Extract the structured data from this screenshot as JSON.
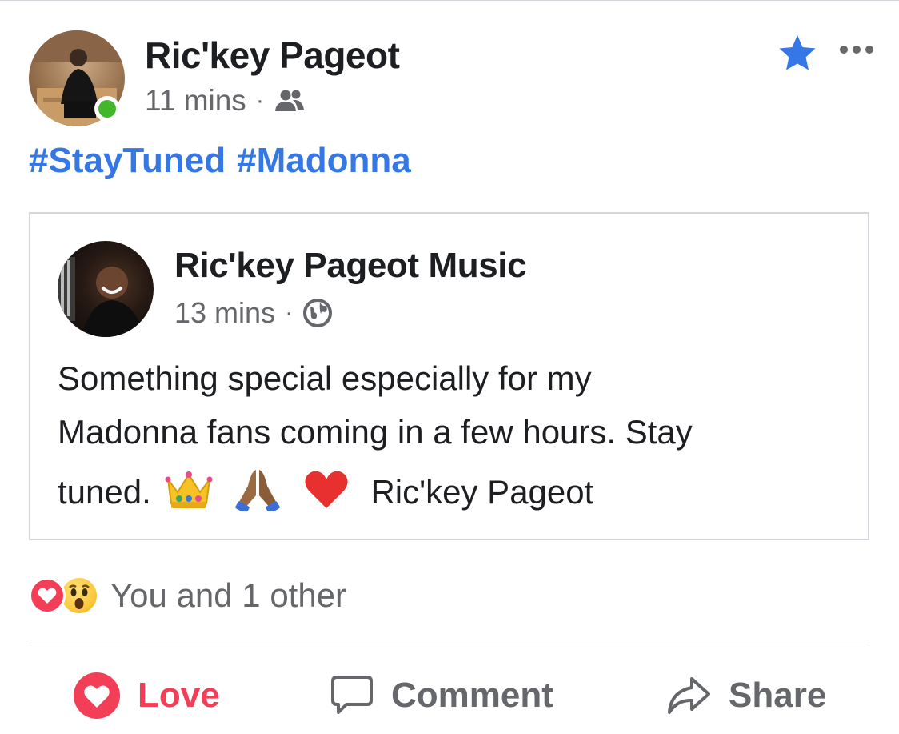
{
  "post": {
    "author": "Ric'key Pageot",
    "time": "11 mins",
    "separator": "·",
    "audience_icon": "friends-icon",
    "hashtags": [
      "#StayTuned",
      "#Madonna"
    ]
  },
  "shared_post": {
    "author": "Ric'key Pageot Music",
    "time": "13 mins",
    "separator": "·",
    "audience_icon": "globe-icon",
    "text_line1": "Something special especially for my",
    "text_line2": "Madonna fans coming in a few hours. Stay",
    "text_line3_start": "tuned.",
    "emojis": [
      "crown",
      "folded-hands",
      "red-heart"
    ],
    "text_line3_end": "Ric'key Pageot"
  },
  "reactions": {
    "icons": [
      "love-reaction",
      "wow-reaction"
    ],
    "summary": "You and 1 other"
  },
  "actions": {
    "love_label": "Love",
    "comment_label": "Comment",
    "share_label": "Share"
  },
  "colors": {
    "link_blue": "#3578e5",
    "love_red": "#f33e58",
    "secondary_text": "#65676b",
    "online_green": "#42b72a"
  }
}
